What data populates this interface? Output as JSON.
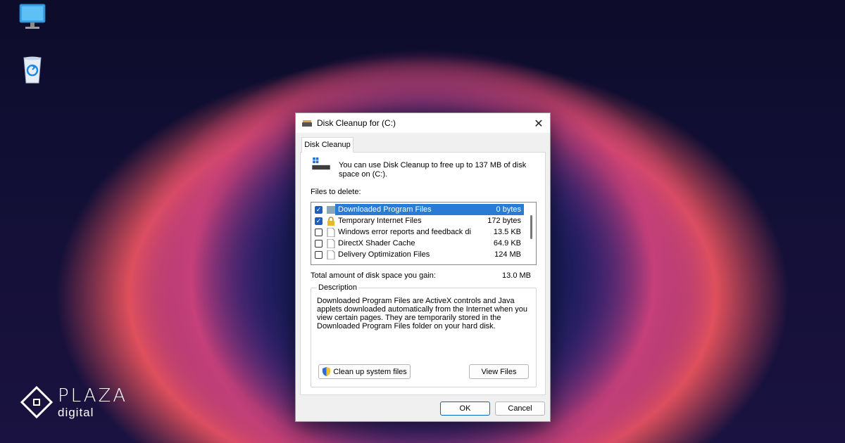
{
  "desktop": {
    "icons": [
      "monitor-icon",
      "recycle-bin-icon"
    ],
    "logo": {
      "brand": "PLAZA",
      "sub": "digital"
    }
  },
  "window": {
    "title": "Disk Cleanup for  (C:)",
    "tab": "Disk Cleanup",
    "intro": "You can use Disk Cleanup to free up to 137 MB of disk space on  (C:).",
    "files_label": "Files to delete:",
    "files": [
      {
        "name": "Downloaded Program Files",
        "size": "0 bytes",
        "checked": true,
        "selected": true
      },
      {
        "name": "Temporary Internet Files",
        "size": "172 bytes",
        "checked": true,
        "selected": false
      },
      {
        "name": "Windows error reports and feedback di...",
        "size": "13.5 KB",
        "checked": false,
        "selected": false
      },
      {
        "name": "DirectX Shader Cache",
        "size": "64.9 KB",
        "checked": false,
        "selected": false
      },
      {
        "name": "Delivery Optimization Files",
        "size": "124 MB",
        "checked": false,
        "selected": false
      }
    ],
    "total_label": "Total amount of disk space you gain:",
    "total_value": "13.0 MB",
    "description_legend": "Description",
    "description": "Downloaded Program Files are ActiveX controls and Java applets downloaded automatically from the Internet when you view certain pages. They are temporarily stored in the Downloaded Program Files folder on your hard disk.",
    "cleanup_button": "Clean up system files",
    "view_button": "View Files",
    "ok_button": "OK",
    "cancel_button": "Cancel"
  },
  "colors": {
    "selection": "#2a7bd4",
    "checkbox": "#1f5fbf"
  }
}
